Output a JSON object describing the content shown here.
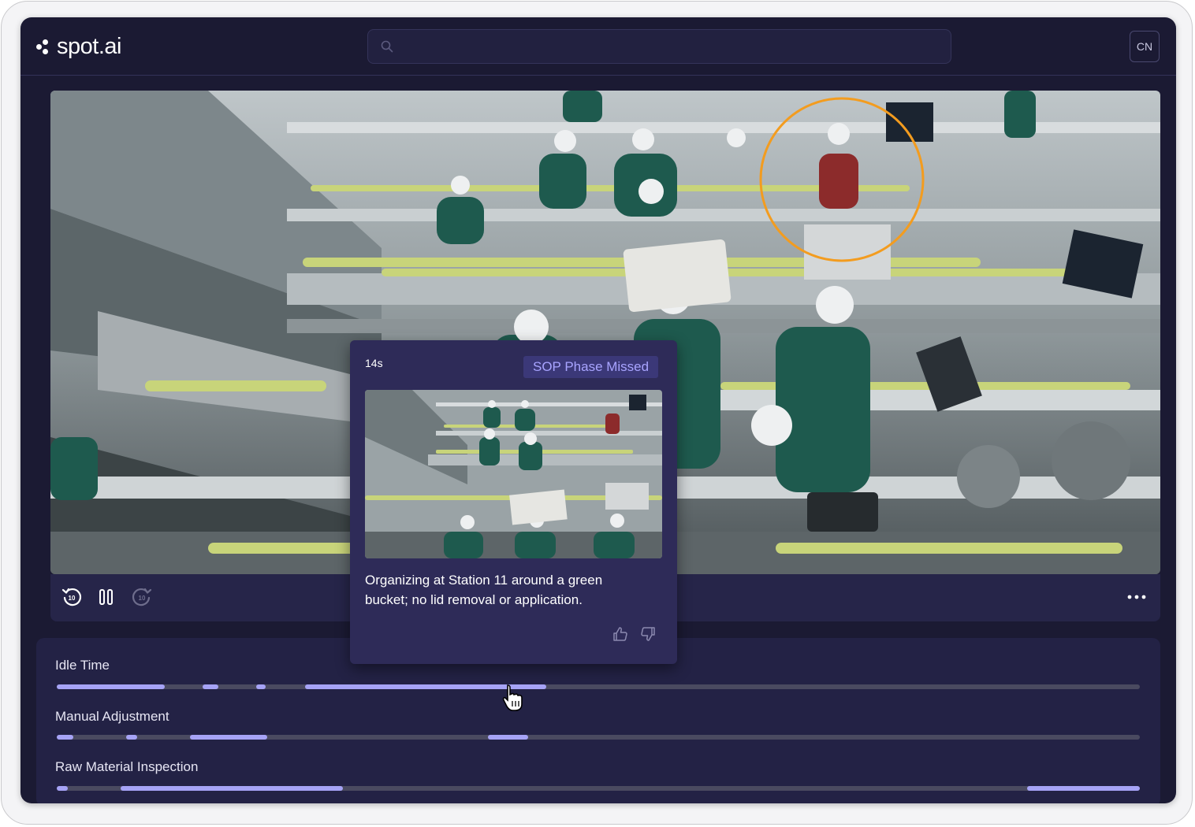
{
  "header": {
    "logo_text": "spot.ai",
    "search_placeholder": "",
    "user_initials": "CN"
  },
  "event_popup": {
    "time": "14s",
    "badge": "SOP Phase Missed",
    "description": "Organizing at Station 11 around a green bucket; no lid removal or application."
  },
  "timeline": {
    "tracks": [
      {
        "label": "Idle Time",
        "segments": [
          [
            0.0,
            0.1
          ],
          [
            0.135,
            0.149
          ],
          [
            0.184,
            0.193
          ],
          [
            0.229,
            0.452
          ]
        ]
      },
      {
        "label": "Manual Adjustment",
        "segments": [
          [
            0.0,
            0.015
          ],
          [
            0.064,
            0.074
          ],
          [
            0.123,
            0.194
          ],
          [
            0.398,
            0.435
          ]
        ]
      },
      {
        "label": "Raw Material Inspection",
        "segments": [
          [
            0.0,
            0.01
          ],
          [
            0.059,
            0.264
          ],
          [
            0.896,
            1.0
          ]
        ]
      }
    ]
  },
  "colors": {
    "background": "#1b1a33",
    "panel": "#232245",
    "accent": "#a6a3f6",
    "highlight_circle": "#f39c1f",
    "badge_text": "#a8a4ff"
  },
  "icons": [
    "search-icon",
    "rewind-10-icon",
    "pause-icon",
    "forward-10-icon",
    "more-icon",
    "thumbs-up-icon",
    "thumbs-down-icon",
    "pointer-cursor-icon"
  ]
}
